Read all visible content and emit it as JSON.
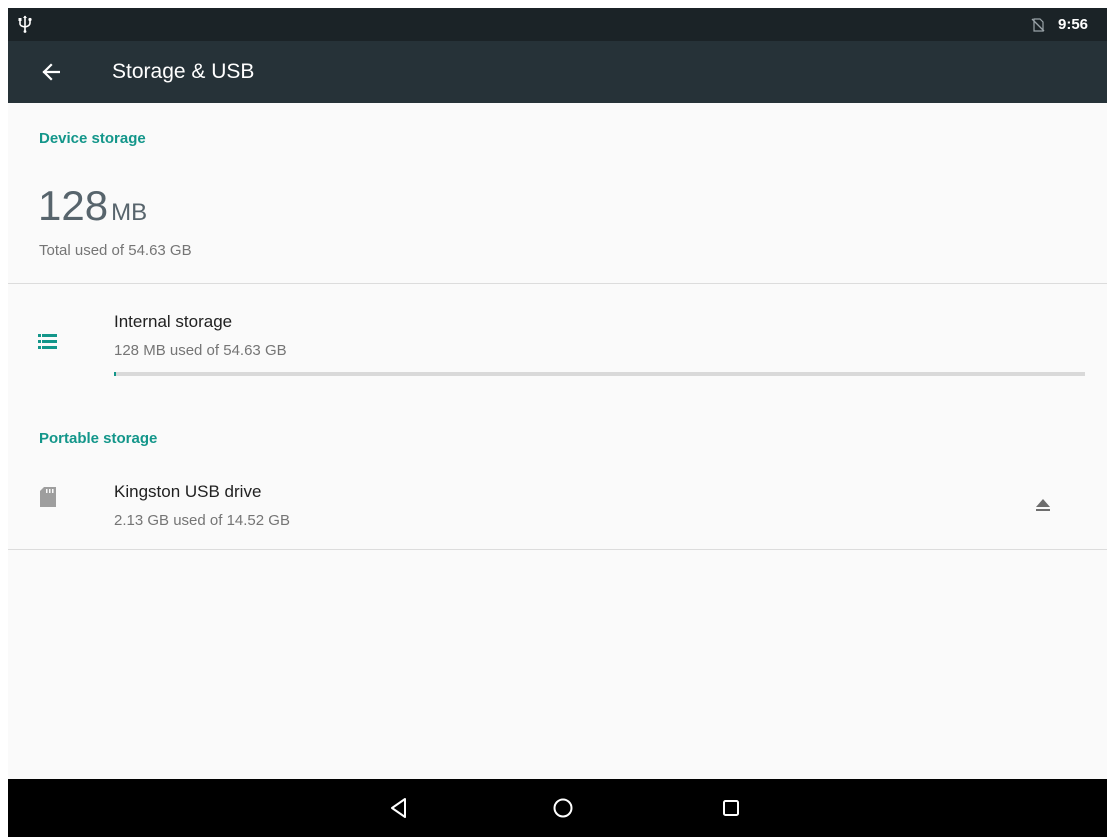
{
  "status_bar": {
    "time": "9:56",
    "left_icon": "usb-icon",
    "right_icon": "no-sim-icon"
  },
  "app_bar": {
    "title": "Storage & USB",
    "back_icon": "back-arrow-icon"
  },
  "device_storage": {
    "header": "Device storage",
    "total_value": "128",
    "total_unit": "MB",
    "total_label": "Total used of 54.63 GB"
  },
  "internal_storage": {
    "title": "Internal storage",
    "subtitle": "128 MB used of 54.63 GB",
    "icon": "storage-list-icon",
    "used_fraction": 0.0023
  },
  "portable_storage": {
    "header": "Portable storage",
    "items": [
      {
        "title": "Kingston USB drive",
        "subtitle": "2.13 GB used of 14.52 GB",
        "icon": "sd-card-icon",
        "action_icon": "eject-icon"
      }
    ]
  },
  "nav_bar": {
    "back_icon": "nav-back-icon",
    "home_icon": "nav-home-icon",
    "recents_icon": "nav-recents-icon"
  },
  "colors": {
    "accent": "#13968a",
    "app_bar": "#263238",
    "status_bar": "#1b2327"
  }
}
